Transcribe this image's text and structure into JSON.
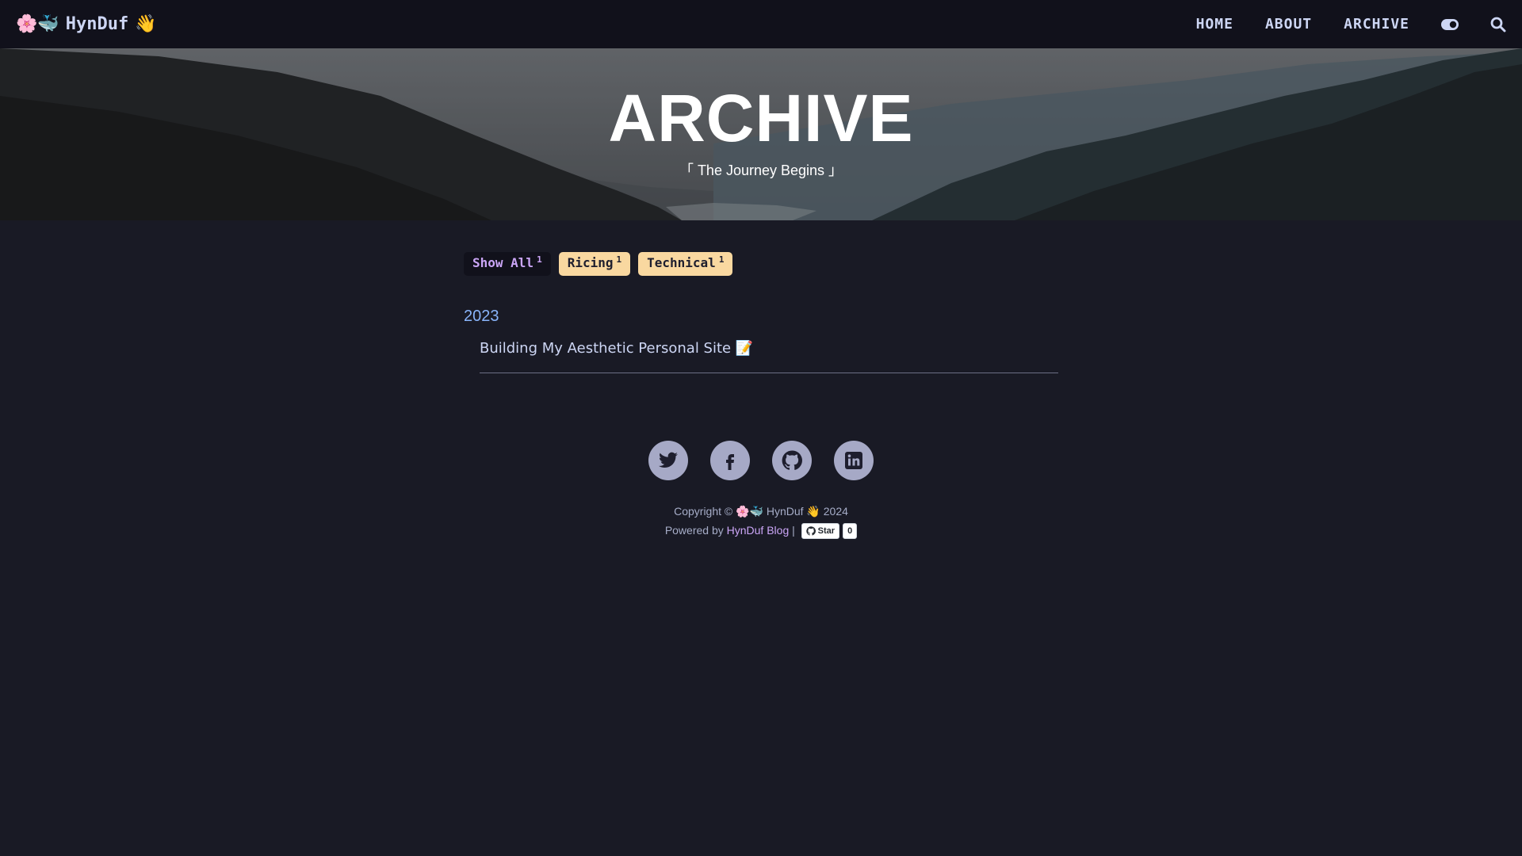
{
  "nav": {
    "brand_emoji": "🌸🐳",
    "brand_name": "HynDuf",
    "brand_wave": "👋",
    "links": [
      "HOME",
      "ABOUT",
      "ARCHIVE"
    ],
    "icons": [
      "theme-toggle-icon",
      "search-icon"
    ]
  },
  "hero": {
    "title": "ARCHIVE",
    "subtitle": "「 The Journey Begins 」"
  },
  "filters": [
    {
      "label": "Show All",
      "count": "1"
    },
    {
      "label": "Ricing",
      "count": "1"
    },
    {
      "label": "Technical",
      "count": "1"
    }
  ],
  "archive": {
    "year": "2023",
    "posts": [
      {
        "title": "Building My Aesthetic Personal Site 📝"
      }
    ]
  },
  "social": [
    "twitter-icon",
    "facebook-icon",
    "github-icon",
    "linkedin-icon"
  ],
  "footer": {
    "copyright": "Copyright © 🌸🐳 HynDuf 👋 2024",
    "powered_prefix": "Powered by",
    "powered_link": "HynDuf Blog",
    "separator": "|",
    "star_label": "Star",
    "star_count": "0"
  },
  "colors": {
    "background": "#191a25",
    "navbar": "#11111b",
    "accent": "#cba6f7",
    "year": "#89b4fa",
    "tag": "#f9d8a0"
  }
}
